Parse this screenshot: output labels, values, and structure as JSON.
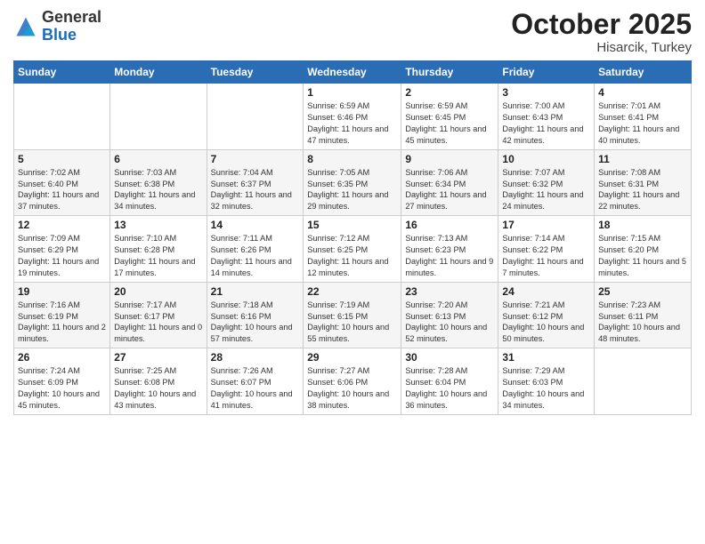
{
  "header": {
    "logo_general": "General",
    "logo_blue": "Blue",
    "month_title": "October 2025",
    "location": "Hisarcik, Turkey"
  },
  "days_of_week": [
    "Sunday",
    "Monday",
    "Tuesday",
    "Wednesday",
    "Thursday",
    "Friday",
    "Saturday"
  ],
  "weeks": [
    [
      {
        "day": "",
        "sunrise": "",
        "sunset": "",
        "daylight": ""
      },
      {
        "day": "",
        "sunrise": "",
        "sunset": "",
        "daylight": ""
      },
      {
        "day": "",
        "sunrise": "",
        "sunset": "",
        "daylight": ""
      },
      {
        "day": "1",
        "sunrise": "Sunrise: 6:59 AM",
        "sunset": "Sunset: 6:46 PM",
        "daylight": "Daylight: 11 hours and 47 minutes."
      },
      {
        "day": "2",
        "sunrise": "Sunrise: 6:59 AM",
        "sunset": "Sunset: 6:45 PM",
        "daylight": "Daylight: 11 hours and 45 minutes."
      },
      {
        "day": "3",
        "sunrise": "Sunrise: 7:00 AM",
        "sunset": "Sunset: 6:43 PM",
        "daylight": "Daylight: 11 hours and 42 minutes."
      },
      {
        "day": "4",
        "sunrise": "Sunrise: 7:01 AM",
        "sunset": "Sunset: 6:41 PM",
        "daylight": "Daylight: 11 hours and 40 minutes."
      }
    ],
    [
      {
        "day": "5",
        "sunrise": "Sunrise: 7:02 AM",
        "sunset": "Sunset: 6:40 PM",
        "daylight": "Daylight: 11 hours and 37 minutes."
      },
      {
        "day": "6",
        "sunrise": "Sunrise: 7:03 AM",
        "sunset": "Sunset: 6:38 PM",
        "daylight": "Daylight: 11 hours and 34 minutes."
      },
      {
        "day": "7",
        "sunrise": "Sunrise: 7:04 AM",
        "sunset": "Sunset: 6:37 PM",
        "daylight": "Daylight: 11 hours and 32 minutes."
      },
      {
        "day": "8",
        "sunrise": "Sunrise: 7:05 AM",
        "sunset": "Sunset: 6:35 PM",
        "daylight": "Daylight: 11 hours and 29 minutes."
      },
      {
        "day": "9",
        "sunrise": "Sunrise: 7:06 AM",
        "sunset": "Sunset: 6:34 PM",
        "daylight": "Daylight: 11 hours and 27 minutes."
      },
      {
        "day": "10",
        "sunrise": "Sunrise: 7:07 AM",
        "sunset": "Sunset: 6:32 PM",
        "daylight": "Daylight: 11 hours and 24 minutes."
      },
      {
        "day": "11",
        "sunrise": "Sunrise: 7:08 AM",
        "sunset": "Sunset: 6:31 PM",
        "daylight": "Daylight: 11 hours and 22 minutes."
      }
    ],
    [
      {
        "day": "12",
        "sunrise": "Sunrise: 7:09 AM",
        "sunset": "Sunset: 6:29 PM",
        "daylight": "Daylight: 11 hours and 19 minutes."
      },
      {
        "day": "13",
        "sunrise": "Sunrise: 7:10 AM",
        "sunset": "Sunset: 6:28 PM",
        "daylight": "Daylight: 11 hours and 17 minutes."
      },
      {
        "day": "14",
        "sunrise": "Sunrise: 7:11 AM",
        "sunset": "Sunset: 6:26 PM",
        "daylight": "Daylight: 11 hours and 14 minutes."
      },
      {
        "day": "15",
        "sunrise": "Sunrise: 7:12 AM",
        "sunset": "Sunset: 6:25 PM",
        "daylight": "Daylight: 11 hours and 12 minutes."
      },
      {
        "day": "16",
        "sunrise": "Sunrise: 7:13 AM",
        "sunset": "Sunset: 6:23 PM",
        "daylight": "Daylight: 11 hours and 9 minutes."
      },
      {
        "day": "17",
        "sunrise": "Sunrise: 7:14 AM",
        "sunset": "Sunset: 6:22 PM",
        "daylight": "Daylight: 11 hours and 7 minutes."
      },
      {
        "day": "18",
        "sunrise": "Sunrise: 7:15 AM",
        "sunset": "Sunset: 6:20 PM",
        "daylight": "Daylight: 11 hours and 5 minutes."
      }
    ],
    [
      {
        "day": "19",
        "sunrise": "Sunrise: 7:16 AM",
        "sunset": "Sunset: 6:19 PM",
        "daylight": "Daylight: 11 hours and 2 minutes."
      },
      {
        "day": "20",
        "sunrise": "Sunrise: 7:17 AM",
        "sunset": "Sunset: 6:17 PM",
        "daylight": "Daylight: 11 hours and 0 minutes."
      },
      {
        "day": "21",
        "sunrise": "Sunrise: 7:18 AM",
        "sunset": "Sunset: 6:16 PM",
        "daylight": "Daylight: 10 hours and 57 minutes."
      },
      {
        "day": "22",
        "sunrise": "Sunrise: 7:19 AM",
        "sunset": "Sunset: 6:15 PM",
        "daylight": "Daylight: 10 hours and 55 minutes."
      },
      {
        "day": "23",
        "sunrise": "Sunrise: 7:20 AM",
        "sunset": "Sunset: 6:13 PM",
        "daylight": "Daylight: 10 hours and 52 minutes."
      },
      {
        "day": "24",
        "sunrise": "Sunrise: 7:21 AM",
        "sunset": "Sunset: 6:12 PM",
        "daylight": "Daylight: 10 hours and 50 minutes."
      },
      {
        "day": "25",
        "sunrise": "Sunrise: 7:23 AM",
        "sunset": "Sunset: 6:11 PM",
        "daylight": "Daylight: 10 hours and 48 minutes."
      }
    ],
    [
      {
        "day": "26",
        "sunrise": "Sunrise: 7:24 AM",
        "sunset": "Sunset: 6:09 PM",
        "daylight": "Daylight: 10 hours and 45 minutes."
      },
      {
        "day": "27",
        "sunrise": "Sunrise: 7:25 AM",
        "sunset": "Sunset: 6:08 PM",
        "daylight": "Daylight: 10 hours and 43 minutes."
      },
      {
        "day": "28",
        "sunrise": "Sunrise: 7:26 AM",
        "sunset": "Sunset: 6:07 PM",
        "daylight": "Daylight: 10 hours and 41 minutes."
      },
      {
        "day": "29",
        "sunrise": "Sunrise: 7:27 AM",
        "sunset": "Sunset: 6:06 PM",
        "daylight": "Daylight: 10 hours and 38 minutes."
      },
      {
        "day": "30",
        "sunrise": "Sunrise: 7:28 AM",
        "sunset": "Sunset: 6:04 PM",
        "daylight": "Daylight: 10 hours and 36 minutes."
      },
      {
        "day": "31",
        "sunrise": "Sunrise: 7:29 AM",
        "sunset": "Sunset: 6:03 PM",
        "daylight": "Daylight: 10 hours and 34 minutes."
      },
      {
        "day": "",
        "sunrise": "",
        "sunset": "",
        "daylight": ""
      }
    ]
  ]
}
